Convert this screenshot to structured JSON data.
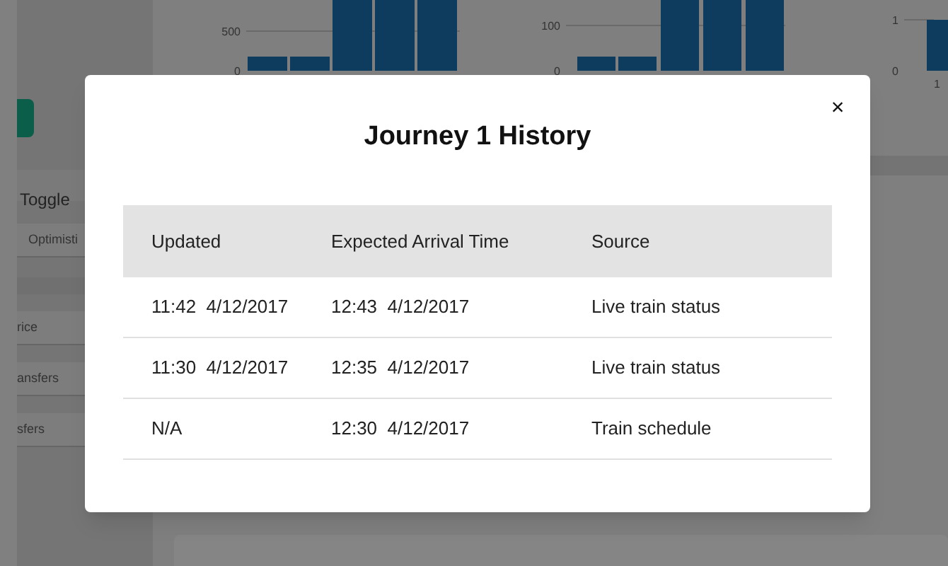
{
  "background": {
    "charts": [
      {
        "ticks": [
          "500",
          "0"
        ]
      },
      {
        "ticks": [
          "100",
          "0"
        ]
      },
      {
        "ticks": [
          "1",
          "0"
        ],
        "x_label": "1"
      }
    ],
    "sidebar": {
      "heading": "Toggle",
      "chip": "Optimisti",
      "items": [
        "rice",
        "ansfers",
        "sfers"
      ]
    }
  },
  "dialog": {
    "title": "Journey 1 History",
    "close": "×",
    "columns": [
      "Updated",
      "Expected Arrival Time",
      "Source"
    ],
    "rows": [
      [
        "11:42  4/12/2017",
        "12:43  4/12/2017",
        "Live train status"
      ],
      [
        "11:30  4/12/2017",
        "12:35  4/12/2017",
        "Live train status"
      ],
      [
        "N/A",
        "12:30  4/12/2017",
        "Train schedule"
      ]
    ]
  }
}
